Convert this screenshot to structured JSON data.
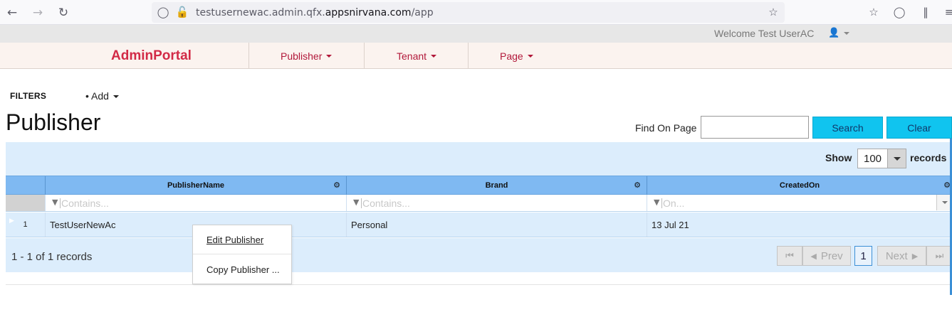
{
  "browser": {
    "url_prefix": "testusernewac.admin.qfx.",
    "url_host": "appsnirvana.com",
    "url_path": "/app"
  },
  "topbar": {
    "welcome": "Welcome Test UserAC"
  },
  "nav": {
    "brand": "AdminPortal",
    "items": [
      {
        "label": "Publisher"
      },
      {
        "label": "Tenant"
      },
      {
        "label": "Page"
      }
    ]
  },
  "filters": {
    "label": "FILTERS",
    "add": "Add"
  },
  "page": {
    "title": "Publisher",
    "find_label": "Find On Page",
    "find_value": "",
    "search_button": "Search",
    "clear_button": "Clear"
  },
  "grid": {
    "show_label": "Show",
    "show_value": "100",
    "records_label": "records",
    "columns": [
      {
        "header": "PublisherName",
        "filter_placeholder": "Contains..."
      },
      {
        "header": "Brand",
        "filter_placeholder": "Contains..."
      },
      {
        "header": "CreatedOn",
        "filter_placeholder": "On..."
      }
    ],
    "rows": [
      {
        "index": "1",
        "publisher_name": "TestUserNewAc",
        "brand": "Personal",
        "created_on": "13 Jul 21"
      }
    ],
    "record_count": "1 - 1 of 1 records",
    "pager": {
      "prev": "Prev",
      "next": "Next",
      "current_page": "1"
    }
  },
  "context_menu": {
    "items": [
      "Edit Publisher",
      "Copy Publisher ..."
    ]
  },
  "colors": {
    "accent": "#10c4ef",
    "brand": "#d22a46",
    "grid_header": "#7fb9f2",
    "grid_row": "#dcedfc"
  }
}
